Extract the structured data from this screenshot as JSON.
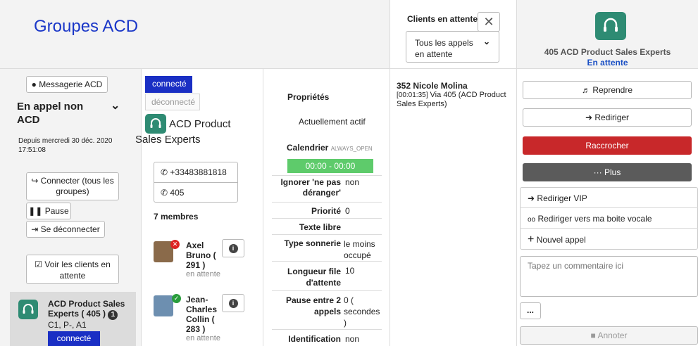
{
  "page_title": "Groupes ACD",
  "agent": {
    "messagerie_label": "Messagerie ACD",
    "status_title": "En appel non ACD",
    "since": "Depuis mercredi 30 déc. 2020 17:51:08",
    "connect_all_label": "Connecter (tous les groupes)",
    "pause_label": "Pause",
    "disconnect_label": "Se déconnecter",
    "view_clients_label": "Voir les clients en attente"
  },
  "group_card": {
    "name": "ACD Product Sales Experts ( 405 )",
    "badge": "1",
    "meta": "C1, P-, A1",
    "status": "connecté"
  },
  "group_detail": {
    "connected_label": "connecté",
    "disconnected_label": "déconnecté",
    "name": "ACD Product Sales Experts",
    "phone1": "+33483881818",
    "phone2": "405",
    "members_count": "7 membres",
    "members": [
      {
        "first": "Axel",
        "last": "Bruno (",
        "ext": "291 )",
        "state": "en attente",
        "badge": "x"
      },
      {
        "first": "Jean-",
        "last": "Charles Collin (",
        "ext": "283 )",
        "state": "en attente",
        "badge": "check"
      }
    ]
  },
  "properties": {
    "heading": "Propriétés",
    "active": "Actuellement actif",
    "calendar_label": "Calendrier",
    "calendar_value": "ALWAYS_OPEN",
    "hours": "00:00 - 00:00",
    "rows": [
      {
        "label": "Ignorer 'ne pas déranger'",
        "value": "non"
      },
      {
        "label": "Priorité",
        "value": "0"
      },
      {
        "label": "Texte libre",
        "value": ""
      },
      {
        "label": "Type sonnerie",
        "value": "le moins occupé"
      },
      {
        "label": "Longueur file d'attente",
        "value": "10"
      },
      {
        "label": "Pause entre 2 appels",
        "value": "0 ( secondes )"
      },
      {
        "label": "Identification",
        "value": "non"
      }
    ]
  },
  "waiting": {
    "title": "Clients en attente",
    "filter_value": "Tous les appels en attente",
    "caller_name": "352 Nicole Molina",
    "caller_time": "[00:01:35]",
    "via_word": "Via",
    "caller_via": "405 (ACD Product Sales Experts)"
  },
  "call_panel": {
    "group_name": "405 ACD Product Sales Experts",
    "status": "En attente",
    "resume_label": "Reprendre",
    "redirect_label": "Rediriger",
    "hangup_label": "Raccrocher",
    "more_label": "Plus",
    "menu": [
      "Rediriger VIP",
      "Rediriger vers ma boite vocale",
      "Nouvel appel"
    ],
    "comment_placeholder": "Tapez un commentaire ici",
    "dots_label": "...",
    "annotate_label": "Annoter"
  },
  "colors": {
    "brand_blue": "#1a37c8",
    "connected_bg": "#1a2fc4",
    "hours_green": "#5ecb6b",
    "hangup_red": "#c8282a",
    "more_gray": "#5b5b5b",
    "link_blue": "#1a4fc4",
    "headset_green": "#2e8b73"
  }
}
